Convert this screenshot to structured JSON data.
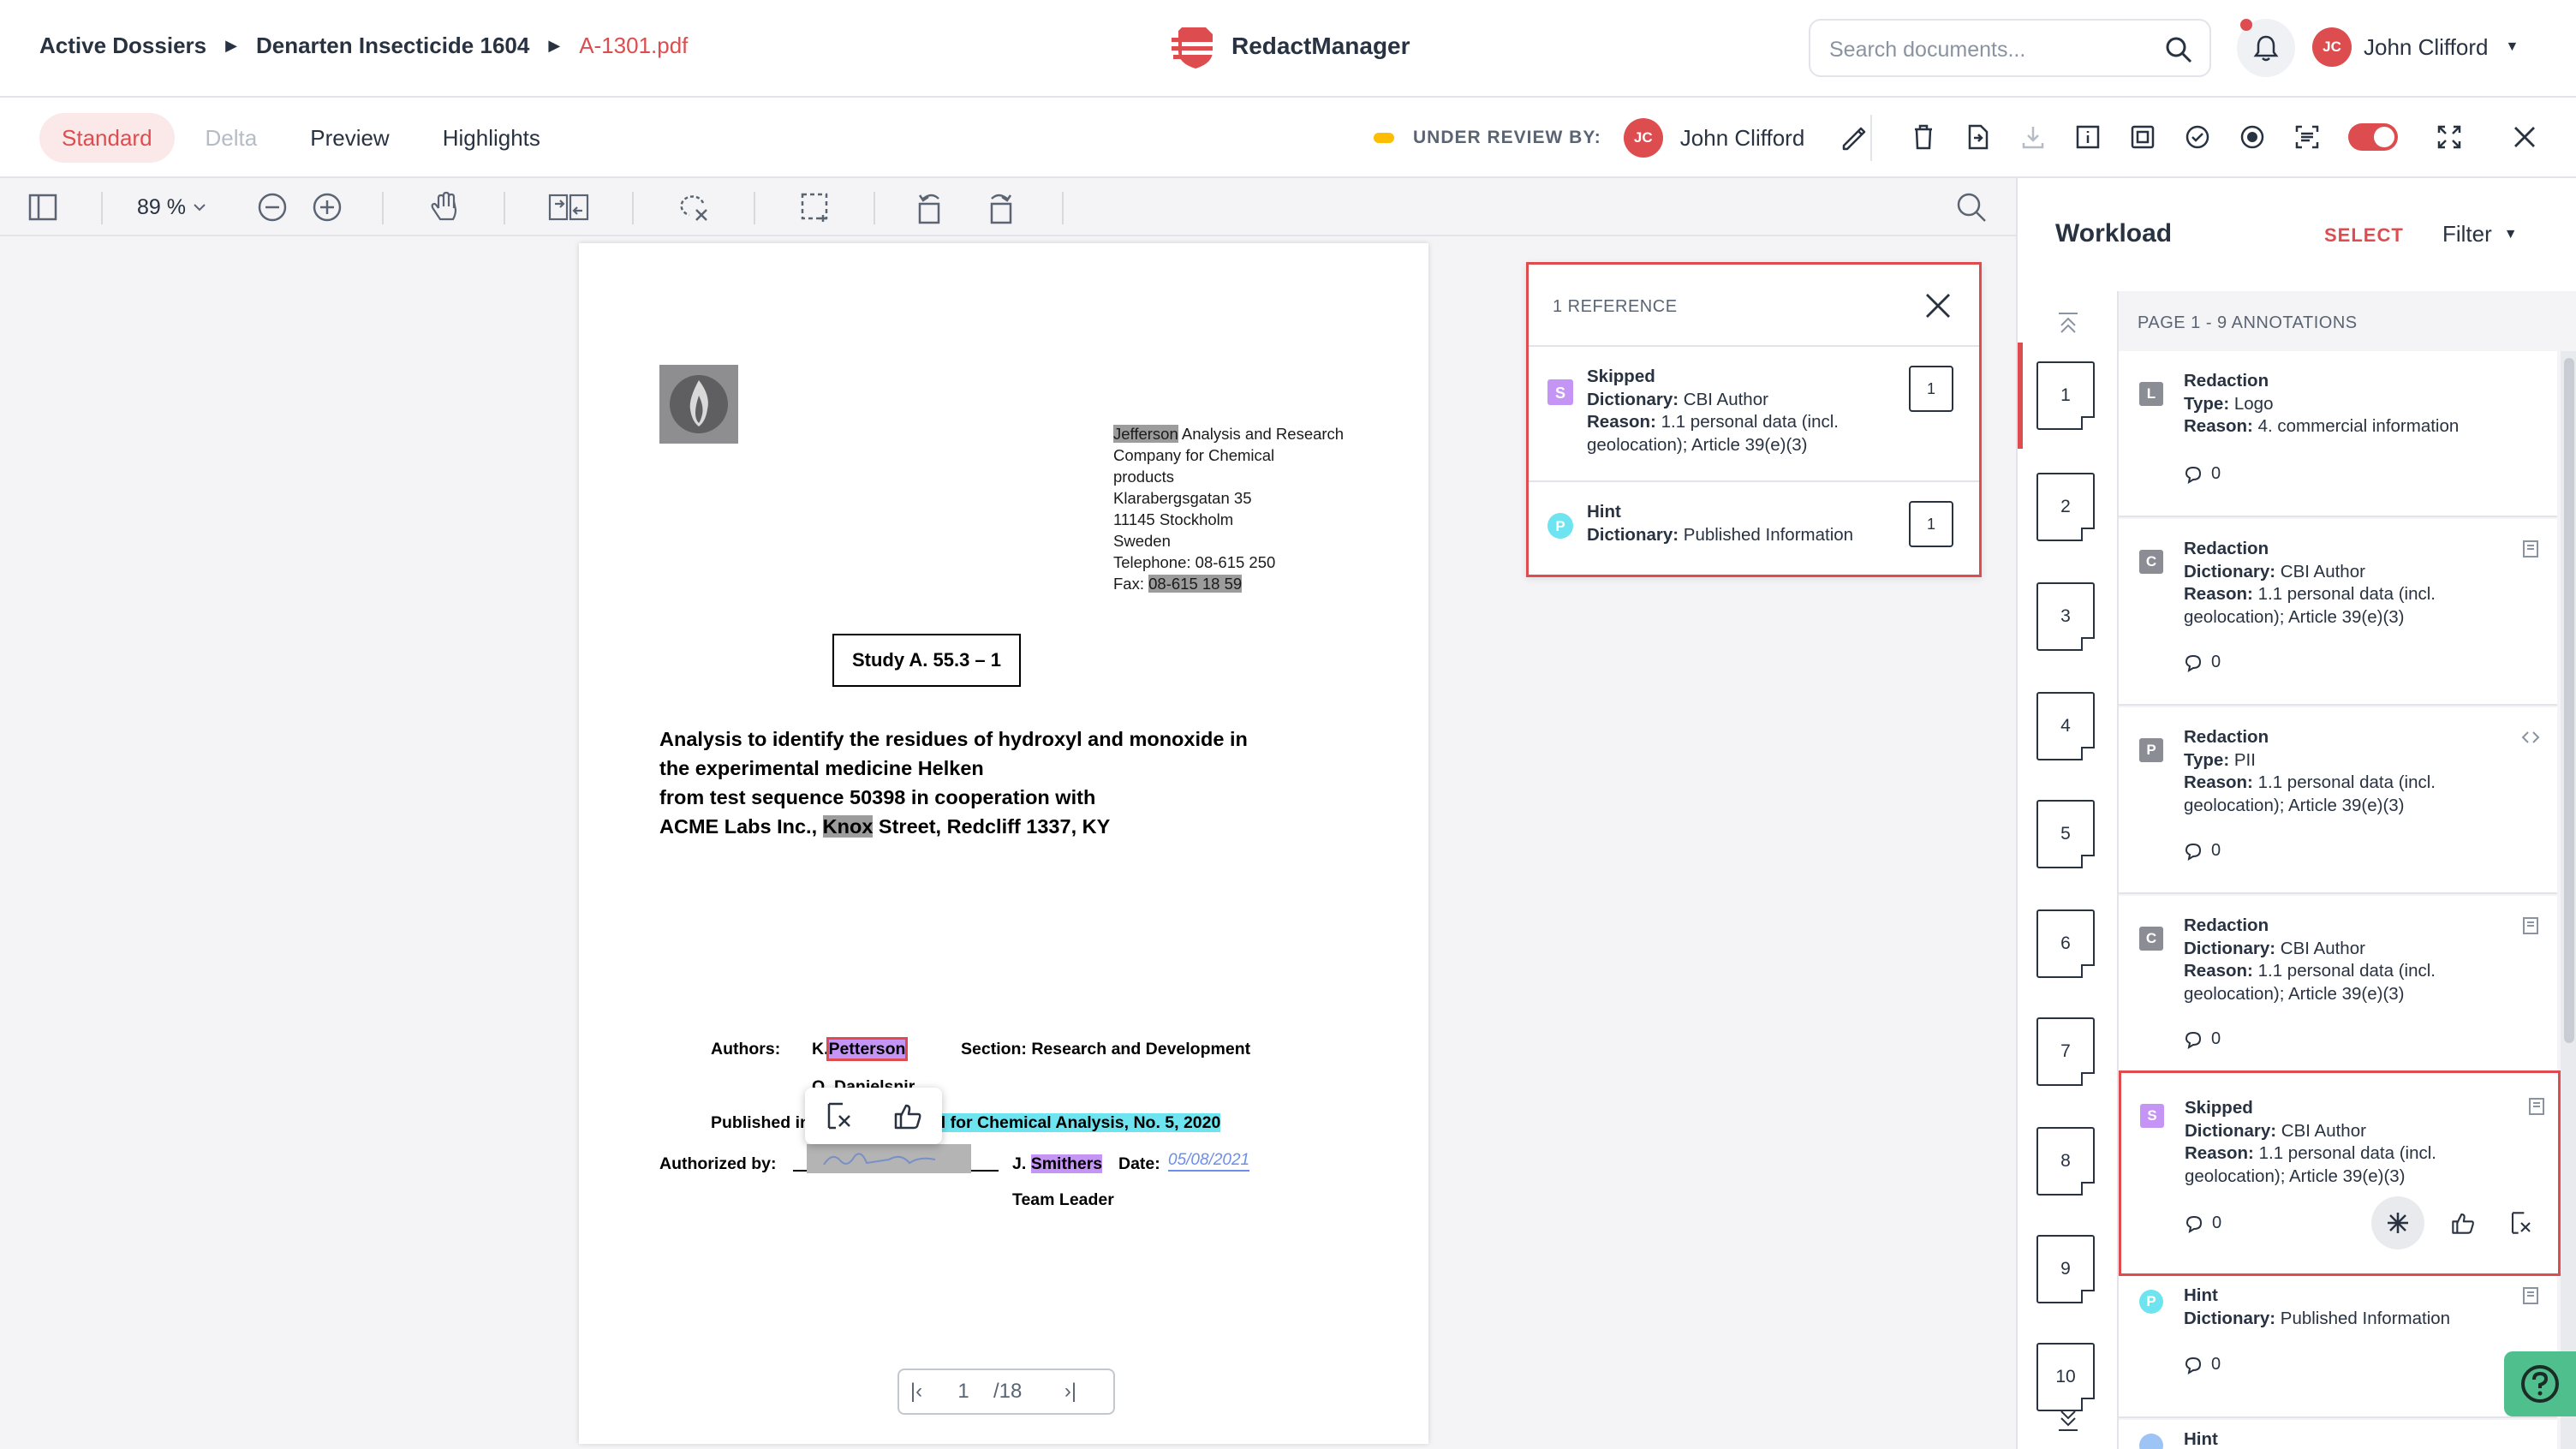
{
  "breadcrumb": {
    "root": "Active Dossiers",
    "dossier": "Denarten Insecticide 1604",
    "file": "A-1301.pdf"
  },
  "brand": {
    "name": "RedactManager"
  },
  "search": {
    "placeholder": "Search documents..."
  },
  "user": {
    "initials": "JC",
    "name": "John Clifford"
  },
  "view_tabs": {
    "standard": "Standard",
    "delta": "Delta",
    "preview": "Preview",
    "highlights": "Highlights"
  },
  "review": {
    "label": "UNDER REVIEW BY:",
    "initials": "JC",
    "name": "John Clifford"
  },
  "zoom": {
    "value": "89 %"
  },
  "document": {
    "address": {
      "line1_hl": "Jefferson",
      "line1_rest": " Analysis and Research",
      "line2": "Company for Chemical",
      "line3": "products",
      "line4": "Klarabergsgatan 35",
      "line5": "11145 Stockholm",
      "line6": "Sweden",
      "line7": "Telephone: 08-615 250",
      "line8_label": "Fax: ",
      "line8_hl": "08-615 18 59"
    },
    "study": "Study A. 55.3 – 1",
    "title": {
      "l1": "Analysis to identify the residues of hydroxyl and monoxide in",
      "l2": "the experimental medicine Helken",
      "l3": "from test sequence 50398 in cooperation with",
      "l4_a": "ACME Labs Inc., ",
      "l4_hl": "Knox",
      "l4_b": " Street, Redcliff 1337, KY"
    },
    "authors_label": "Authors:",
    "author1_prefix": "K.",
    "author1_name": "Petterson",
    "author2": "O. Danielsnir",
    "section": "Section: Research and Development",
    "published_label": "Published in",
    "journal": "nal for Chemical Analysis, No. 5, 2020",
    "authorized_label": "Authorized by:",
    "smithers_prefix": "J. ",
    "smithers": "Smithers",
    "date_label": "Date:",
    "date_value": "05/08/2021",
    "team_leader": "Team Leader"
  },
  "pager": {
    "current": "1",
    "total": "/18"
  },
  "reference_popup": {
    "title": "1 REFERENCE",
    "items": [
      {
        "badge": "S",
        "type": "Skipped",
        "dict_label": "Dictionary:",
        "dict": "CBI Author",
        "reason_label": "Reason:",
        "reason": "1.1 personal data (incl. geolocation); Article 39(e)(3)",
        "page": "1"
      },
      {
        "badge": "P",
        "type": "Hint",
        "dict_label": "Dictionary:",
        "dict": "Published Information",
        "page": "1"
      }
    ]
  },
  "workload": {
    "title": "Workload",
    "select": "SELECT",
    "filter": "Filter",
    "list_header": "PAGE 1 - 9 ANNOTATIONS",
    "pages": [
      "1",
      "2",
      "3",
      "4",
      "5",
      "6",
      "7",
      "8",
      "9",
      "10"
    ],
    "annotations": [
      {
        "badge": "L",
        "title": "Redaction",
        "l2_label": "Type:",
        "l2": "Logo",
        "r_label": "Reason:",
        "reason": "4. commercial information",
        "comments": "0"
      },
      {
        "badge": "C",
        "title": "Redaction",
        "l2_label": "Dictionary:",
        "l2": "CBI Author",
        "r_label": "Reason:",
        "reason": "1.1 personal data (incl. geolocation); Article 39(e)(3)",
        "comments": "0"
      },
      {
        "badge": "P",
        "title": "Redaction",
        "l2_label": "Type:",
        "l2": "PII",
        "r_label": "Reason:",
        "reason": "1.1 personal data (incl. geolocation); Article 39(e)(3)",
        "comments": "0"
      },
      {
        "badge": "C",
        "title": "Redaction",
        "l2_label": "Dictionary:",
        "l2": "CBI Author",
        "r_label": "Reason:",
        "reason": "1.1 personal data (incl. geolocation); Article 39(e)(3)",
        "comments": "0"
      },
      {
        "badge": "S",
        "title": "Skipped",
        "l2_label": "Dictionary:",
        "l2": "CBI Author",
        "r_label": "Reason:",
        "reason": "1.1 personal data (incl. geolocation); Article 39(e)(3)",
        "comments": "0"
      },
      {
        "badge": "P",
        "title": "Hint",
        "l2_label": "Dictionary:",
        "l2": "Published Information",
        "comments": "0"
      },
      {
        "title": "Hint"
      }
    ]
  },
  "colors": {
    "accent": "#dd4d50",
    "skipped": "#c595f5",
    "hint": "#6de4ef",
    "gray_badge": "#8a8d93",
    "help": "#4fc08d"
  }
}
